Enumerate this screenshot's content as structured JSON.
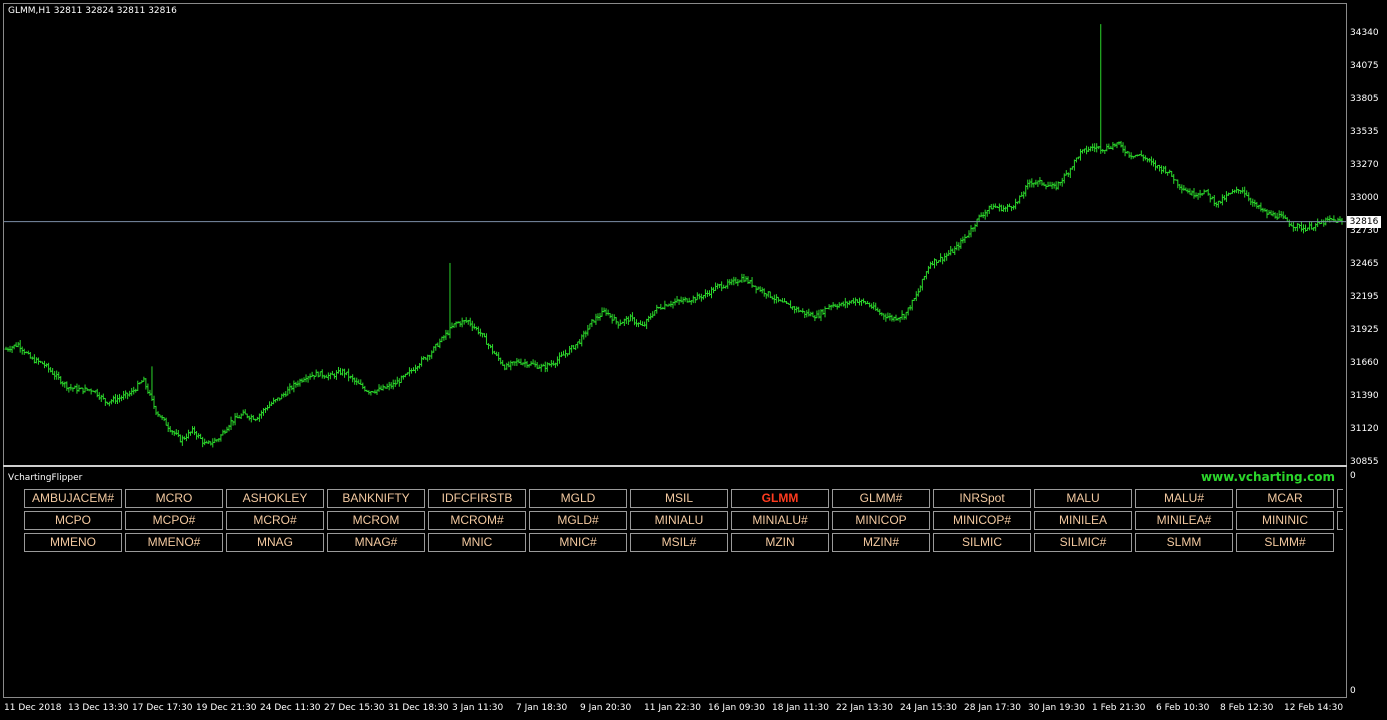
{
  "window": {
    "title": "GLMM,H1  32811 32824 32811 32816",
    "indicator_label": "VchartingFlipper",
    "brand": "www.vcharting.com",
    "sub_scale_top": "0",
    "sub_scale_bottom": "0"
  },
  "colors": {
    "candles": "#2bd62b",
    "price_line": "#7d8fa8",
    "button_text": "#f3c9a0",
    "active_button_text": "#ff3b1f",
    "brand": "#2bd62b"
  },
  "current_price_label": "32816",
  "buttons": {
    "rows": [
      [
        "AMBUJACEM#",
        "MCRO",
        "ASHOKLEY",
        "BANKNIFTY",
        "IDFCFIRSTB",
        "MGLD",
        "MSIL",
        "GLMM",
        "GLMM#",
        "INRSpot",
        "MALU",
        "MALU#",
        "MCAR"
      ],
      [
        "MCPO",
        "MCPO#",
        "MCRO#",
        "MCROM",
        "MCROM#",
        "MGLD#",
        "MINIALU",
        "MINIALU#",
        "MINICOP",
        "MINICOP#",
        "MINILEA",
        "MINILEA#",
        "MININIC"
      ],
      [
        "MMENO",
        "MMENO#",
        "MNAG",
        "MNAG#",
        "MNIC",
        "MNIC#",
        "MSIL#",
        "MZIN",
        "MZIN#",
        "SILMIC",
        "SILMIC#",
        "SLMM",
        "SLMM#"
      ]
    ],
    "active": "GLMM"
  },
  "chart_data": {
    "type": "bar",
    "title": "GLMM,H1  32811 32824 32811 32816",
    "xlabel": "",
    "ylabel": "",
    "ylim": [
      30850,
      34430
    ],
    "y_ticks": [
      "34340",
      "34075",
      "33805",
      "33535",
      "33270",
      "33000",
      "32730",
      "32465",
      "32195",
      "31925",
      "31660",
      "31390",
      "31120",
      "30855"
    ],
    "x_ticks": [
      "11 Dec 2018",
      "13 Dec 13:30",
      "17 Dec 17:30",
      "19 Dec 21:30",
      "24 Dec 11:30",
      "27 Dec 15:30",
      "31 Dec 18:30",
      "3 Jan 11:30",
      "7 Jan 18:30",
      "9 Jan 20:30",
      "11 Jan 22:30",
      "16 Jan 09:30",
      "18 Jan 11:30",
      "22 Jan 13:30",
      "24 Jan 15:30",
      "28 Jan 17:30",
      "30 Jan 19:30",
      "1 Feb 21:30",
      "6 Feb 10:30",
      "8 Feb 12:30",
      "12 Feb 14:30"
    ],
    "current_price": 32816,
    "grid": false,
    "series": [
      {
        "close_path": [
          31780,
          31820,
          31700,
          31660,
          31560,
          31470,
          31450,
          31450,
          31350,
          31380,
          31420,
          31530,
          31280,
          31150,
          31040,
          31120,
          31000,
          31050,
          31190,
          31250,
          31220,
          31320,
          31390,
          31480,
          31560,
          31580,
          31560,
          31600,
          31510,
          31440,
          31450,
          31490,
          31560,
          31660,
          31750,
          31870,
          31990,
          32010,
          31910,
          31760,
          31630,
          31680,
          31660,
          31630,
          31680,
          31760,
          31850,
          32010,
          32090,
          31990,
          32030,
          31960,
          32100,
          32150,
          32170,
          32190,
          32220,
          32290,
          32310,
          32360,
          32290,
          32230,
          32160,
          32120,
          32070,
          32050,
          32140,
          32140,
          32180,
          32150,
          32070,
          32030,
          32060,
          32230,
          32480,
          32520,
          32590,
          32710,
          32860,
          32940,
          32920,
          32970,
          33140,
          33130,
          33090,
          33210,
          33370,
          33420,
          33410,
          33450,
          33360,
          33350,
          33270,
          33230,
          33110,
          33040,
          33060,
          32960,
          33040,
          33080,
          32950,
          32880,
          32860,
          32790,
          32760,
          32790,
          32830,
          32816
        ]
      }
    ]
  }
}
